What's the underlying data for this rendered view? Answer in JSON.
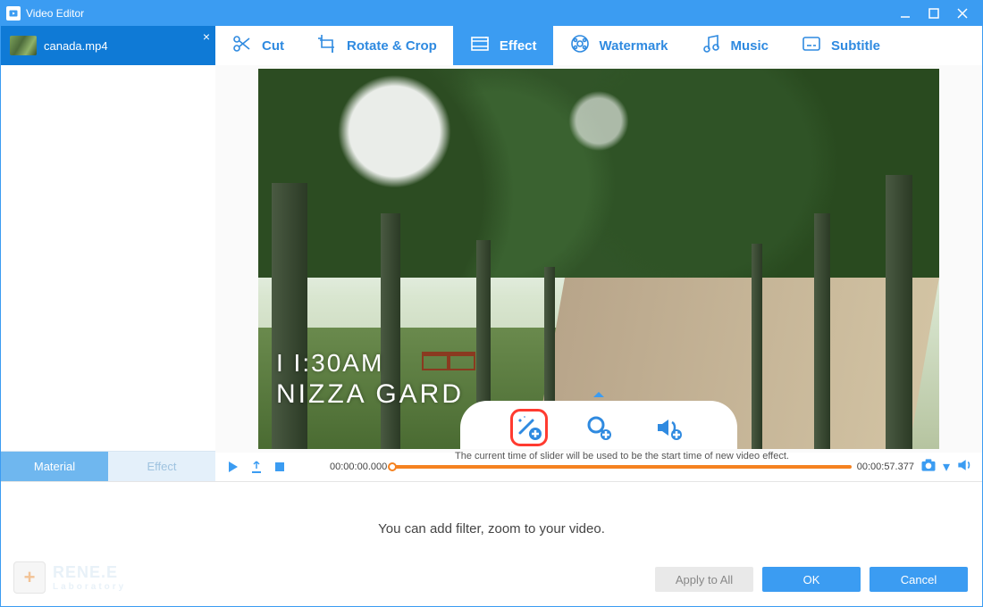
{
  "window": {
    "title": "Video Editor"
  },
  "file_tab": {
    "name": "canada.mp4"
  },
  "sidebar_tabs": {
    "material": "Material",
    "effect": "Effect"
  },
  "toolbar": {
    "cut": "Cut",
    "rotate": "Rotate & Crop",
    "effect": "Effect",
    "watermark": "Watermark",
    "music": "Music",
    "subtitle": "Subtitle"
  },
  "overlay": {
    "time": "I I:30AM",
    "place": "NIZZA GARD"
  },
  "timeline": {
    "start": "00:00:00.000",
    "end": "00:00:57.377",
    "help": "The current time of slider will be used to be the start time of new video effect."
  },
  "bottom": {
    "hint": "You can add filter, zoom to your video.",
    "brand1": "RENE.E",
    "brand2": "Laboratory",
    "apply_all": "Apply to All",
    "ok": "OK",
    "cancel": "Cancel"
  }
}
